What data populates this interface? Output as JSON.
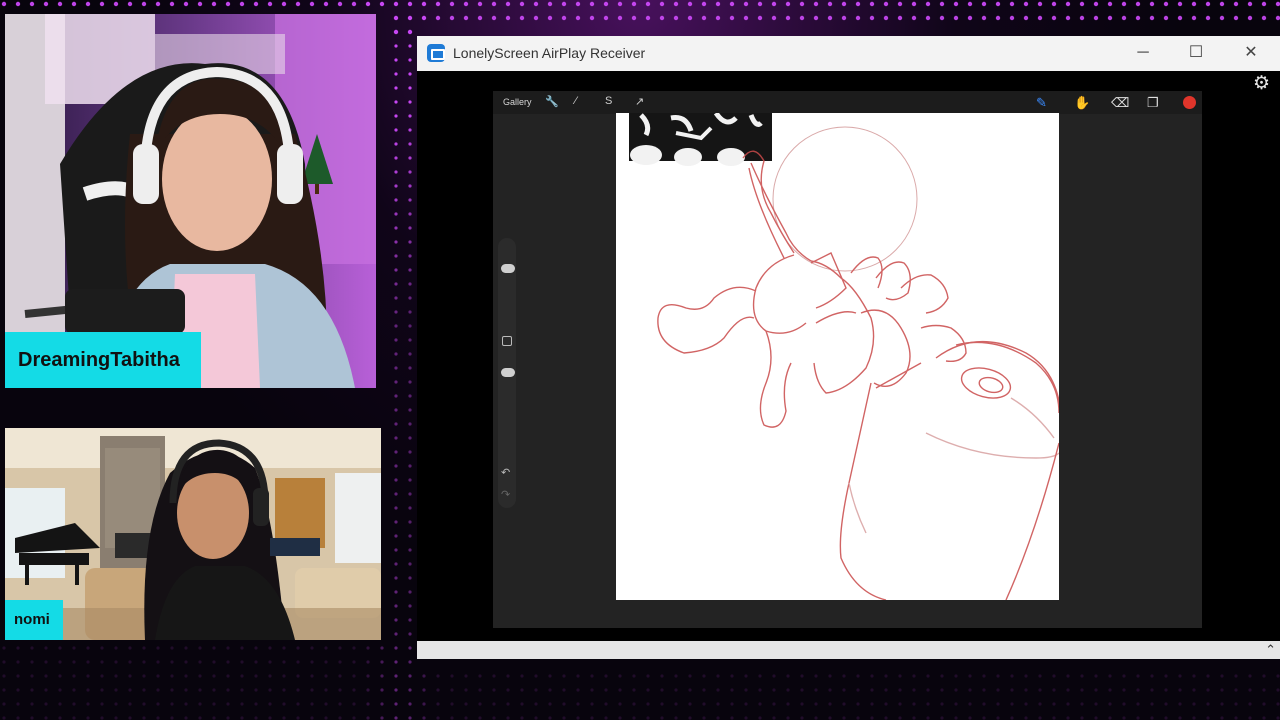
{
  "stream": {
    "participants": [
      {
        "name": "DreamingTabitha"
      },
      {
        "name": "nomi"
      }
    ],
    "accent_color": "#14dbe6",
    "background_color": "#08040d",
    "glow_color": "#d24bff"
  },
  "airplay_window": {
    "title": "LonelyScreen AirPlay Receiver",
    "controls": {
      "minimize": "─",
      "maximize": "☐",
      "close": "✕"
    },
    "settings_icon": "gear-icon",
    "scroll_icon": "chevron-up-icon"
  },
  "procreate": {
    "gallery_label": "Gallery",
    "toolbar_left": [
      "wrench-icon",
      "magic-wand-icon",
      "selection-icon",
      "transform-icon"
    ],
    "toolbar_right": [
      "brush-icon",
      "smudge-icon",
      "eraser-icon",
      "layers-icon",
      "color-swatch"
    ],
    "brush_color": "#e0352b",
    "sidebar": [
      "brush-size-slider",
      "modify-button",
      "opacity-slider",
      "undo-button",
      "redo-button"
    ]
  }
}
